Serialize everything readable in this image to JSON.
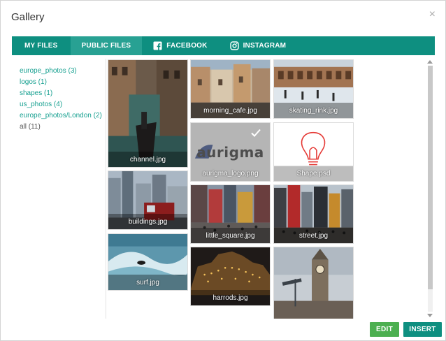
{
  "dialog": {
    "title": "Gallery",
    "close_glyph": "×"
  },
  "tabs": [
    {
      "label": "MY FILES",
      "icon": null
    },
    {
      "label": "PUBLIC FILES",
      "icon": null,
      "active": true
    },
    {
      "label": "FACEBOOK",
      "icon": "facebook-icon"
    },
    {
      "label": "INSTAGRAM",
      "icon": "instagram-icon"
    }
  ],
  "folders": [
    {
      "label": "europe_photos (3)"
    },
    {
      "label": "logos (1)"
    },
    {
      "label": "shapes (1)"
    },
    {
      "label": "us_photos (4)"
    },
    {
      "label": "europe_photos/London (2)"
    },
    {
      "label": "all (11)",
      "current": true
    }
  ],
  "images": [
    {
      "name": "channel.jpg"
    },
    {
      "name": "buildings.jpg"
    },
    {
      "name": "surf.jpg"
    },
    {
      "name": "morning_cafe.jpg"
    },
    {
      "name": "aurigma_logo.png",
      "selected": true,
      "logo_text": "aurigma"
    },
    {
      "name": "little_square.jpg"
    },
    {
      "name": "harrods.jpg"
    },
    {
      "name": "skating_rink.jpg"
    },
    {
      "name": "Shape.psd"
    },
    {
      "name": "street.jpg"
    },
    {
      "name": ""
    }
  ],
  "buttons": {
    "edit": "EDIT",
    "insert": "INSERT"
  },
  "colors": {
    "tab_bar": "#0e8f80",
    "tab_active": "#28a193",
    "link": "#16a090",
    "edit_button": "#4caf50",
    "insert_button": "#0e8f80"
  }
}
